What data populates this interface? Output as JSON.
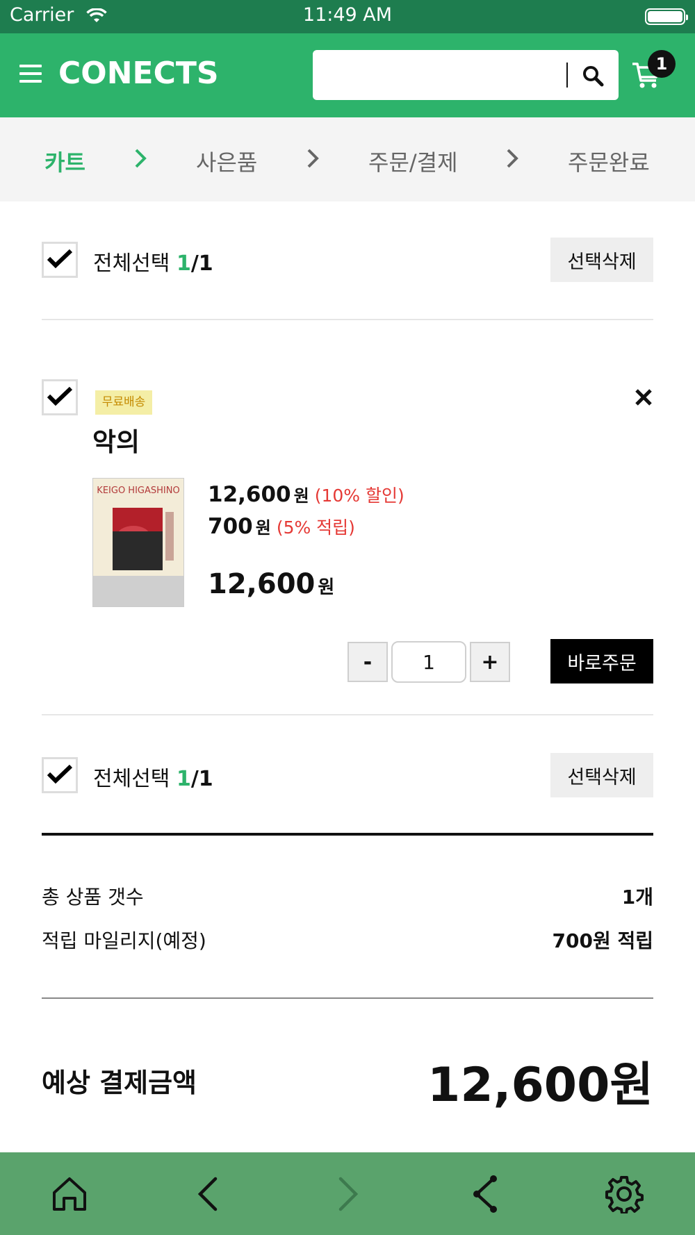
{
  "status_bar": {
    "carrier": "Carrier",
    "time": "11:49 AM"
  },
  "header": {
    "logo": "CONECTS",
    "search_value": "",
    "cart_count": "1"
  },
  "steps": [
    "카트",
    "사은품",
    "주문/결제",
    "주문완료"
  ],
  "select_all": {
    "label": "전체선택",
    "count": "1",
    "total": "/1",
    "delete_label": "선택삭제"
  },
  "item": {
    "badge": "무료배송",
    "title": "악의",
    "cover_author": "KEIGO HIGASHINO",
    "price": "12,600",
    "price_unit": "원",
    "discount_note": "(10% 할인)",
    "points": "700",
    "points_unit": "원",
    "points_note": "(5% 적립)",
    "final_price": "12,600",
    "final_unit": "원",
    "quantity": "1",
    "minus_label": "-",
    "plus_label": "+",
    "buy_now_label": "바로주문"
  },
  "summary": {
    "total_count_label": "총 상품 갯수",
    "total_count_value": "1개",
    "mileage_label": "적립 마일리지(예정)",
    "mileage_value": "700원 적립",
    "payment_label": "예상 결제금액",
    "payment_value": "12,600원"
  },
  "colors": {
    "brand_green": "#2db36b",
    "status_green": "#1e7d4f",
    "bottom_bar": "#5aa36c",
    "discount_red": "#e53935"
  },
  "bottom_nav": [
    "home-icon",
    "back-icon",
    "forward-icon",
    "share-icon",
    "settings-icon"
  ]
}
